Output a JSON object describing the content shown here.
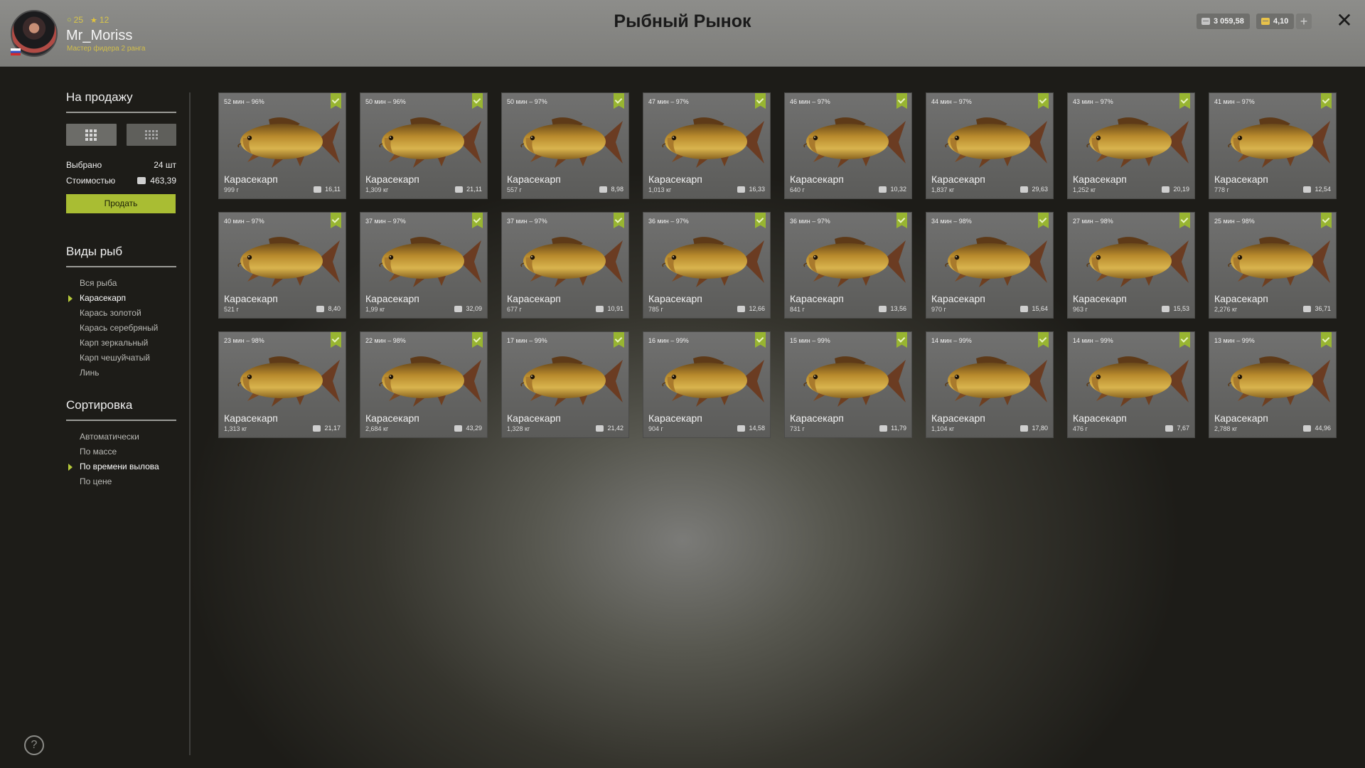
{
  "user": {
    "level": "25",
    "stars": "12",
    "name": "Mr_Moriss",
    "rank": "Мастер фидера 2 ранга"
  },
  "title": "Рыбный Рынок",
  "currency": {
    "silver": "3 059,58",
    "gold": "4,10"
  },
  "sidebar": {
    "for_sale_title": "На продажу",
    "selected_label": "Выбрано",
    "selected_value": "24 шт",
    "cost_label": "Стоимостью",
    "cost_value": "463,39",
    "sell_button": "Продать",
    "species_title": "Виды рыб",
    "species": [
      {
        "label": "Вся рыба",
        "active": false
      },
      {
        "label": "Карасекарп",
        "active": true
      },
      {
        "label": "Карась золотой",
        "active": false
      },
      {
        "label": "Карась серебряный",
        "active": false
      },
      {
        "label": "Карп зеркальный",
        "active": false
      },
      {
        "label": "Карп чешуйчатый",
        "active": false
      },
      {
        "label": "Линь",
        "active": false
      }
    ],
    "sort_title": "Сортировка",
    "sort": [
      {
        "label": "Автоматически",
        "active": false
      },
      {
        "label": "По массе",
        "active": false
      },
      {
        "label": "По времени вылова",
        "active": true
      },
      {
        "label": "По цене",
        "active": false
      }
    ]
  },
  "fish": [
    {
      "time": "52 мин – 96%",
      "name": "Карасекарп",
      "weight": "999 г",
      "price": "16,11"
    },
    {
      "time": "50 мин – 96%",
      "name": "Карасекарп",
      "weight": "1,309 кг",
      "price": "21,11"
    },
    {
      "time": "50 мин – 97%",
      "name": "Карасекарп",
      "weight": "557 г",
      "price": "8,98"
    },
    {
      "time": "47 мин – 97%",
      "name": "Карасекарп",
      "weight": "1,013 кг",
      "price": "16,33"
    },
    {
      "time": "46 мин – 97%",
      "name": "Карасекарп",
      "weight": "640 г",
      "price": "10,32"
    },
    {
      "time": "44 мин – 97%",
      "name": "Карасекарп",
      "weight": "1,837 кг",
      "price": "29,63"
    },
    {
      "time": "43 мин – 97%",
      "name": "Карасекарп",
      "weight": "1,252 кг",
      "price": "20,19"
    },
    {
      "time": "41 мин – 97%",
      "name": "Карасекарп",
      "weight": "778 г",
      "price": "12,54"
    },
    {
      "time": "40 мин – 97%",
      "name": "Карасекарп",
      "weight": "521 г",
      "price": "8,40"
    },
    {
      "time": "37 мин – 97%",
      "name": "Карасекарп",
      "weight": "1,99 кг",
      "price": "32,09"
    },
    {
      "time": "37 мин – 97%",
      "name": "Карасекарп",
      "weight": "677 г",
      "price": "10,91"
    },
    {
      "time": "36 мин – 97%",
      "name": "Карасекарп",
      "weight": "785 г",
      "price": "12,66"
    },
    {
      "time": "36 мин – 97%",
      "name": "Карасекарп",
      "weight": "841 г",
      "price": "13,56"
    },
    {
      "time": "34 мин – 98%",
      "name": "Карасекарп",
      "weight": "970 г",
      "price": "15,64"
    },
    {
      "time": "27 мин – 98%",
      "name": "Карасекарп",
      "weight": "963 г",
      "price": "15,53"
    },
    {
      "time": "25 мин – 98%",
      "name": "Карасекарп",
      "weight": "2,276 кг",
      "price": "36,71"
    },
    {
      "time": "23 мин – 98%",
      "name": "Карасекарп",
      "weight": "1,313 кг",
      "price": "21,17"
    },
    {
      "time": "22 мин – 98%",
      "name": "Карасекарп",
      "weight": "2,684 кг",
      "price": "43,29"
    },
    {
      "time": "17 мин – 99%",
      "name": "Карасекарп",
      "weight": "1,328 кг",
      "price": "21,42"
    },
    {
      "time": "16 мин – 99%",
      "name": "Карасекарп",
      "weight": "904 г",
      "price": "14,58"
    },
    {
      "time": "15 мин – 99%",
      "name": "Карасекарп",
      "weight": "731 г",
      "price": "11,79"
    },
    {
      "time": "14 мин – 99%",
      "name": "Карасекарп",
      "weight": "1,104 кг",
      "price": "17,80"
    },
    {
      "time": "14 мин – 99%",
      "name": "Карасекарп",
      "weight": "476 г",
      "price": "7,67"
    },
    {
      "time": "13 мин – 99%",
      "name": "Карасекарп",
      "weight": "2,788 кг",
      "price": "44,96"
    }
  ],
  "help": "?",
  "close": "✕",
  "plus": "+",
  "colors": {
    "accent": "#a9bd33",
    "badge": "#98b531"
  }
}
